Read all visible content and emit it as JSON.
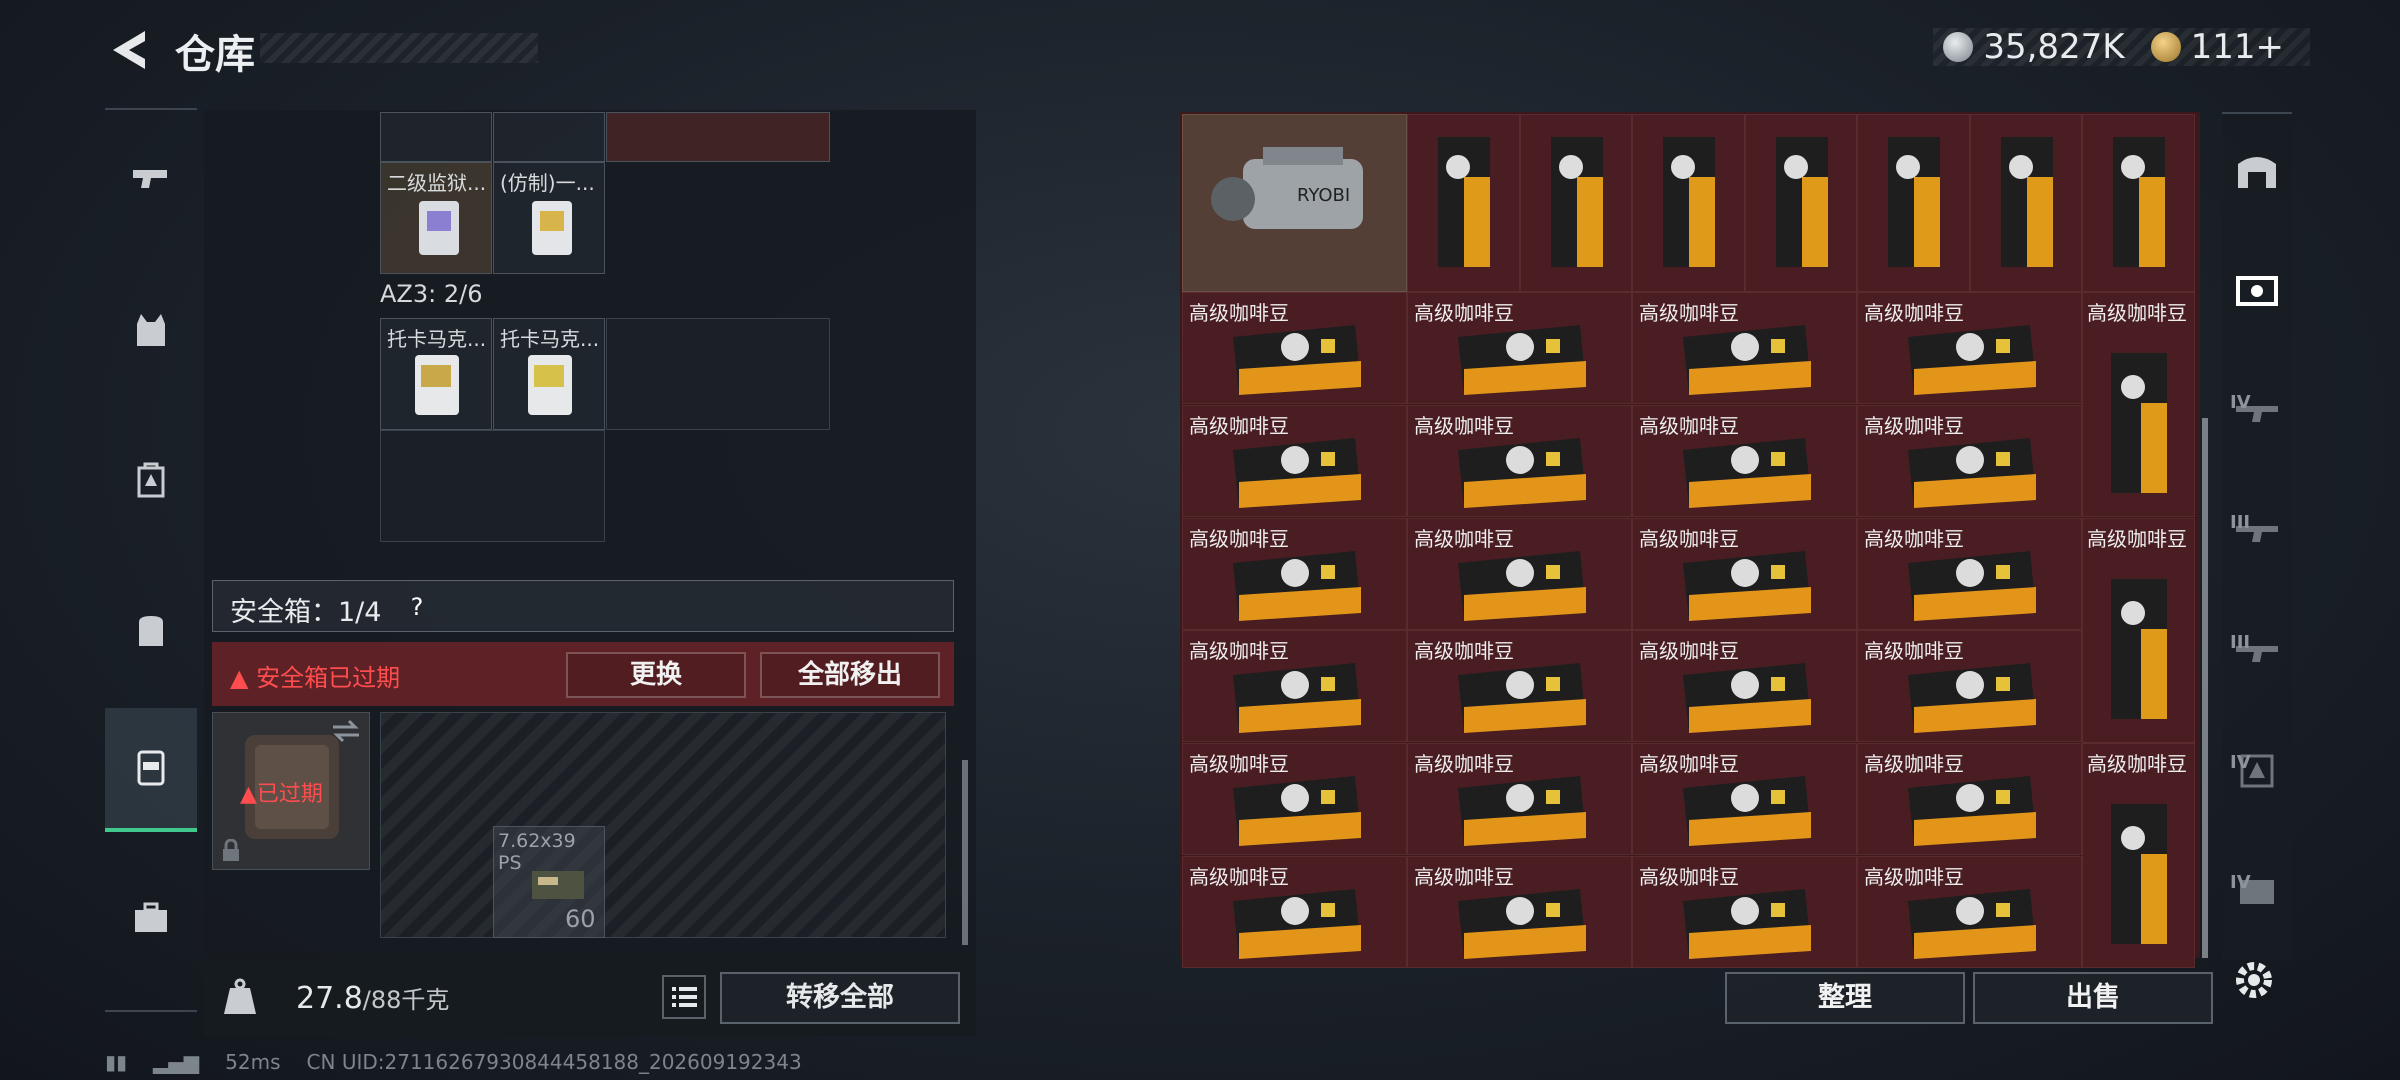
{
  "header": {
    "title": "仓库"
  },
  "currency": {
    "silver": "35,827K",
    "gold": "111+"
  },
  "left_rail": {
    "items": [
      {
        "icon": "pistol-icon"
      },
      {
        "icon": "vest-icon"
      },
      {
        "icon": "backpack-tier-icon"
      },
      {
        "icon": "backpack-icon"
      },
      {
        "icon": "safe-box-icon"
      },
      {
        "icon": "toolbox-icon"
      }
    ]
  },
  "storage": {
    "top_items": [
      {
        "label": "二级监狱..."
      },
      {
        "label": "(仿制)一..."
      }
    ],
    "az3_label": "AZ3: 2/6",
    "az3_items": [
      {
        "label": "托卡马克..."
      },
      {
        "label": "托卡马克..."
      }
    ]
  },
  "safe_box": {
    "label": "安全箱：1/4",
    "help": "?",
    "expired_warning": "安全箱已过期",
    "replace_button": "更换",
    "move_all_button": "全部移出",
    "case_status": "已过期",
    "ammo_name": "7.62x39 PS",
    "ammo_count": "60"
  },
  "weight": {
    "current": "27.8",
    "max": "/88千克"
  },
  "transfer_all_button": "转移全部",
  "status": {
    "ping": "52ms",
    "uid": "CN UID:27116267930844458188_202609192343"
  },
  "stash": {
    "item_label": "高级咖啡豆",
    "drill_brand": "RYOBI"
  },
  "sort_button": "整理",
  "sell_button": "出售",
  "right_rail": {
    "tiers": [
      "IV",
      "III",
      "III",
      "IV",
      "IV"
    ]
  },
  "colors": {
    "accent": "#3fc98d",
    "danger": "#ff4d4f",
    "stash_bg": "#4a1d22"
  }
}
